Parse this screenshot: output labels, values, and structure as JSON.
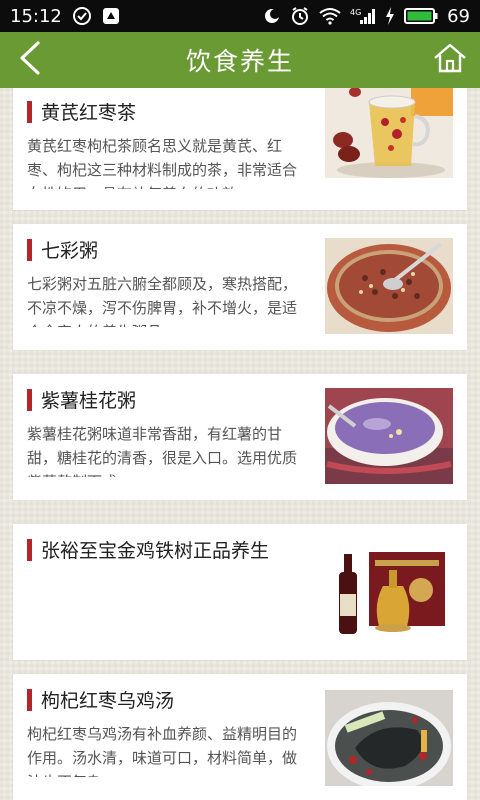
{
  "status_bar": {
    "time": "15:12",
    "battery_percent": "69",
    "signal_label": "4G"
  },
  "header": {
    "title": "饮食养生"
  },
  "articles": [
    {
      "title": "黄芪红枣茶",
      "description": "黄芪红枣枸杞茶顾名思义就是黄芪、红枣、枸杞这三种材料制成的茶，非常适合女性饮用，具有补气养血的功效。"
    },
    {
      "title": "七彩粥",
      "description": "七彩粥对五脏六腑全都顾及，寒热搭配，不凉不燥，泻不伤脾胃，补不增火，是适合全家人的养生粥品。"
    },
    {
      "title": "紫薯桂花粥",
      "description": "紫薯桂花粥味道非常香甜，有红薯的甘甜，糖桂花的清香，很是入口。选用优质紫薯熬制而成。"
    },
    {
      "title": "张裕至宝金鸡铁树正品养生",
      "description": ""
    },
    {
      "title": "枸杞红枣乌鸡汤",
      "description": "枸杞红枣乌鸡汤有补血养颜、益精明目的作用。汤水清，味道可口，材料简单，做法也不复杂。"
    }
  ]
}
